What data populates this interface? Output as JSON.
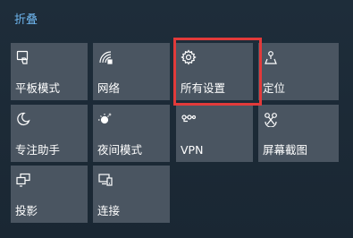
{
  "header": {
    "collapse_label": "折叠"
  },
  "tiles": [
    {
      "label": "平板模式",
      "icon": "tablet-mode-icon"
    },
    {
      "label": "网络",
      "icon": "network-icon"
    },
    {
      "label": "所有设置",
      "icon": "gear-icon"
    },
    {
      "label": "定位",
      "icon": "location-icon"
    },
    {
      "label": "专注助手",
      "icon": "moon-icon"
    },
    {
      "label": "夜间模式",
      "icon": "night-light-icon"
    },
    {
      "label": "VPN",
      "icon": "vpn-icon"
    },
    {
      "label": "屏幕截图",
      "icon": "snip-icon"
    },
    {
      "label": "投影",
      "icon": "project-icon"
    },
    {
      "label": "连接",
      "icon": "connect-icon"
    }
  ],
  "colors": {
    "tile_background": "#4a5561",
    "link": "#6fb6ef",
    "highlight": "#e23a3a"
  }
}
